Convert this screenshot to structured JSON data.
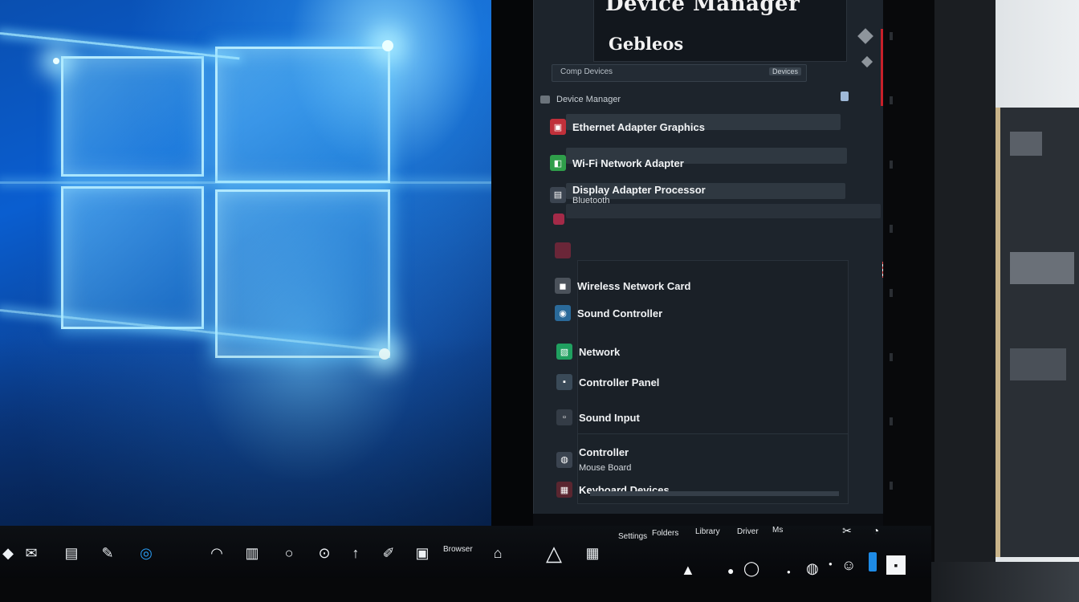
{
  "window": {
    "title": "Device Manager",
    "subtitle": "Gebleos",
    "address": "Comp Devices",
    "address_button": "Devices",
    "root_label": "Device Manager"
  },
  "devices": [
    {
      "label": "Ethernet Adapter Graphics",
      "icon_color": "#c0303a",
      "glyph": "▣"
    },
    {
      "label": "Wi-Fi Network Adapter",
      "icon_color": "#2f9e4a",
      "glyph": "◧"
    },
    {
      "label": "Display Adapter Processor",
      "sub": "Bluetooth",
      "icon_color": "#3b4450",
      "glyph": "▤"
    },
    {
      "label": "",
      "icon_color": "#a42a48",
      "glyph": "●"
    },
    {
      "label": "Wireless Network Card",
      "icon_color": "#4b525b",
      "glyph": "◼"
    },
    {
      "label": "Sound Controller",
      "icon_color": "#2a6a9a",
      "glyph": "◉"
    },
    {
      "label": "Network",
      "icon_color": "#20a060",
      "glyph": "▧"
    },
    {
      "label": "Controller Panel",
      "icon_color": "#3a4a58",
      "glyph": "▪"
    },
    {
      "label": "Sound Input",
      "icon_color": "#343c46",
      "glyph": "▫"
    },
    {
      "label": "Controller",
      "sub2": "Mouse Board",
      "icon_color": "#3b4450",
      "glyph": "◍"
    },
    {
      "label": "Keyboard Devices",
      "icon_color": "#5a2630",
      "glyph": "▦"
    }
  ],
  "taskbar": {
    "labels": [
      "Browser",
      "Settings",
      "Folders",
      "Library",
      "Driver",
      "Ms"
    ],
    "icons": [
      "start-icon",
      "mail-icon",
      "files-icon",
      "cortana-icon",
      "edge-icon",
      "store-icon",
      "settings-icon",
      "search-icon",
      "pen-icon",
      "window-icon",
      "home-icon",
      "app-icon"
    ]
  },
  "colors": {
    "accent": "#0a78d7",
    "window_bg": "#1d242c",
    "scrollbar": "#c8202a"
  }
}
